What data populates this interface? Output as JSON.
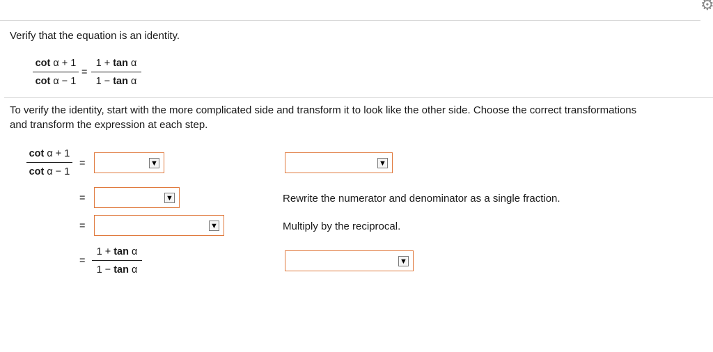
{
  "problem": {
    "prompt": "Verify that the equation is an identity.",
    "equation": {
      "left_num": [
        "cot",
        " α + 1"
      ],
      "left_den": [
        "cot",
        " α − 1"
      ],
      "equals": "=",
      "right_num": [
        "1 + ",
        "tan",
        " α"
      ],
      "right_den": [
        "1 − ",
        "tan",
        " α"
      ]
    }
  },
  "instructions": {
    "line1": "To verify the identity, start with the more complicated side and transform it to look like the other side. Choose the correct transformations",
    "line2": "and transform the expression at each step."
  },
  "steps": {
    "start_num": [
      "cot",
      " α + 1"
    ],
    "start_den": [
      "cot",
      " α − 1"
    ],
    "equals": "=",
    "step2_reason": "Rewrite the numerator and denominator as a single fraction.",
    "step3_reason": "Multiply by the reciprocal.",
    "end_num": [
      "1 + ",
      "tan",
      " α"
    ],
    "end_den": [
      "1 − ",
      "tan",
      " α"
    ],
    "dropdowns": {
      "step1_expr": {
        "value": ""
      },
      "step1_reason": {
        "value": ""
      },
      "step2_expr": {
        "value": ""
      },
      "step3_expr": {
        "value": ""
      },
      "step4_reason": {
        "value": ""
      }
    },
    "dropdown_arrow": "▼"
  },
  "icons": {
    "settings": "gear-icon"
  },
  "colors": {
    "dropdown_border": "#e07a3e",
    "divider": "#d9d9d9"
  }
}
